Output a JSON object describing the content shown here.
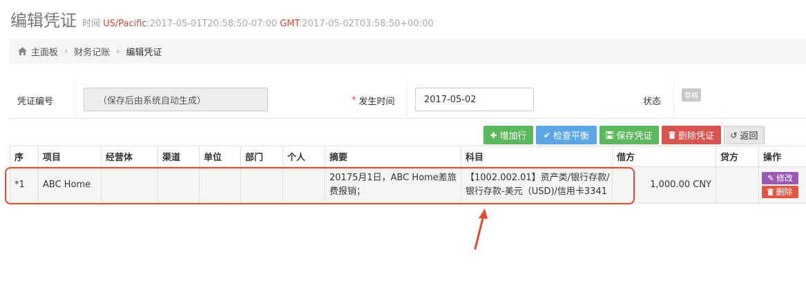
{
  "header": {
    "title": "编辑凭证",
    "time_label": "时间",
    "tz_local": "US/Pacific",
    "time_local": ":2017-05-01T20:58:50-07:00",
    "tz_gmt": "GMT",
    "time_gmt": ":2017-05-02T03:58:50+00:00"
  },
  "breadcrumb": {
    "home": "主面板",
    "level2": "财务记账",
    "current": "编辑凭证"
  },
  "form": {
    "voucher_no_label": "凭证编号",
    "voucher_no_value": "（保存后由系统自动生成）",
    "date_label": "发生时间",
    "date_required_mark": "*",
    "date_value": "2017-05-02",
    "status_label": "状态",
    "status_value": "草稿"
  },
  "toolbar": {
    "add_row": "增加行",
    "check_balance": "检查平衡",
    "save": "保存凭证",
    "delete": "删除凭证",
    "back": "返回"
  },
  "table": {
    "headers": [
      "序",
      "项目",
      "经营体",
      "渠道",
      "单位",
      "部门",
      "个人",
      "摘要",
      "科目",
      "借方",
      "贷方",
      "操作"
    ],
    "rows": [
      {
        "seq": "*1",
        "project": "ABC Home",
        "business": "",
        "channel": "",
        "unit": "",
        "dept": "",
        "person": "",
        "summary": "20175月1日，ABC Home差旅费报销；",
        "account": "【1002.002.01】资产类/银行存款/银行存款-美元（USD)/信用卡3341",
        "debit": "1,000.00 CNY",
        "credit": "",
        "edit_label": "修改",
        "delete_label": "删除"
      }
    ]
  },
  "colors": {
    "accent_red": "#e8482b",
    "green": "#5cb85c",
    "blue": "#5ba7e6",
    "danger": "#d9534f",
    "purple": "#9b59b6"
  }
}
